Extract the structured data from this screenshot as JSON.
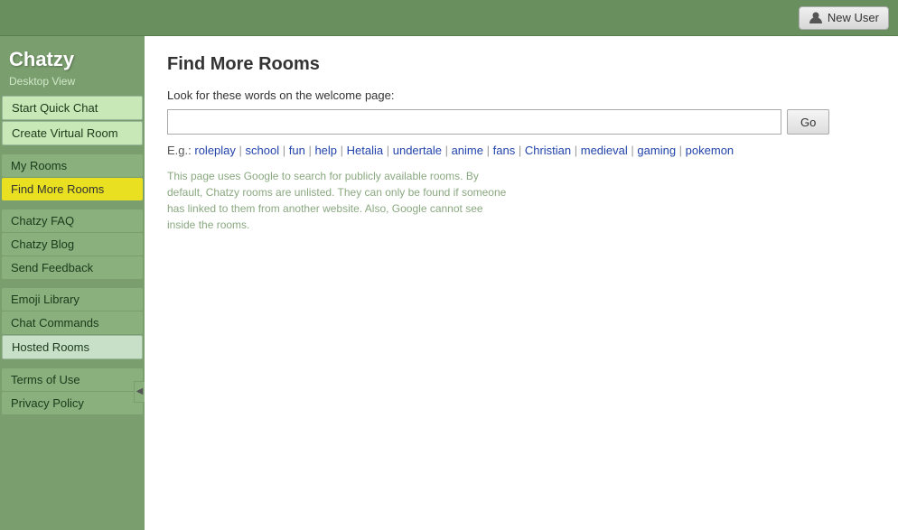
{
  "topbar": {
    "new_user_label": "New User"
  },
  "sidebar": {
    "logo": "Chatzy",
    "desktop_view": "Desktop View",
    "items": [
      {
        "id": "start-quick-chat",
        "label": "Start Quick Chat",
        "active": false,
        "style": "highlight"
      },
      {
        "id": "create-virtual-room",
        "label": "Create Virtual Room",
        "active": false,
        "style": "highlight"
      },
      {
        "id": "my-rooms",
        "label": "My Rooms",
        "active": false,
        "style": "normal"
      },
      {
        "id": "find-more-rooms",
        "label": "Find More Rooms",
        "active": true,
        "style": "normal"
      },
      {
        "id": "chatzy-faq",
        "label": "Chatzy FAQ",
        "active": false,
        "style": "normal"
      },
      {
        "id": "chatzy-blog",
        "label": "Chatzy Blog",
        "active": false,
        "style": "normal"
      },
      {
        "id": "send-feedback",
        "label": "Send Feedback",
        "active": false,
        "style": "normal"
      },
      {
        "id": "emoji-library",
        "label": "Emoji Library",
        "active": false,
        "style": "normal"
      },
      {
        "id": "chat-commands",
        "label": "Chat Commands",
        "active": false,
        "style": "normal"
      },
      {
        "id": "hosted-rooms",
        "label": "Hosted Rooms",
        "active": false,
        "style": "hosted"
      },
      {
        "id": "terms-of-use",
        "label": "Terms of Use",
        "active": false,
        "style": "normal"
      },
      {
        "id": "privacy-policy",
        "label": "Privacy Policy",
        "active": false,
        "style": "normal"
      }
    ]
  },
  "main": {
    "title": "Find More Rooms",
    "search_label": "Look for these words on the welcome page:",
    "search_placeholder": "",
    "go_button": "Go",
    "examples_label": "E.g.:",
    "examples": [
      "roleplay",
      "school",
      "fun",
      "help",
      "Hetalia",
      "undertale",
      "anime",
      "fans",
      "Christian",
      "medieval",
      "gaming",
      "pokemon"
    ],
    "info_text": "This page uses Google to search for publicly available rooms. By default, Chatzy rooms are unlisted. They can only be found if someone has linked to them from another website. Also, Google cannot see inside the rooms."
  }
}
